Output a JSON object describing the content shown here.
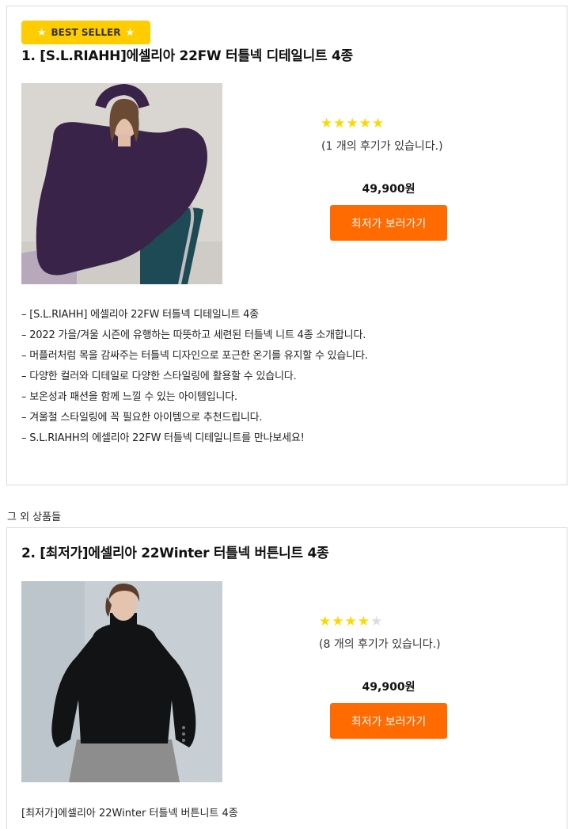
{
  "products": [
    {
      "badge": "BEST SELLER",
      "title": "1. [S.L.RIAHH]에셀리아 22FW 터틀넥 디테일니트 4종",
      "rating": 5,
      "stars_on": "★★★★★",
      "stars_off": "",
      "reviews": "(1 개의 후기가 있습니다.)",
      "price": "49,900원",
      "cta": "최저가 보러가기",
      "description": [
        "– [S.L.RIAHH] 에셀리아 22FW 터틀넥 디테일니트 4종",
        "– 2022 가을/겨울 시즌에 유행하는 따뜻하고 세련된 터틀넥 니트 4종 소개합니다.",
        "– 머플러처럼 목을 감싸주는 터틀넥 디자인으로 포근한 온기를 유지할 수 있습니다.",
        "– 다양한 컬러와 디테일로 다양한 스타일링에 활용할 수 있습니다.",
        "– 보온성과 패션을 함께 느낄 수 있는 아이템입니다.",
        "– 겨울철 스타일링에 꼭 필요한 아이템으로 추천드립니다.",
        "– S.L.RIAHH의 에셀리아 22FW 터틀넥 디테일니트를 만나보세요!"
      ]
    },
    {
      "title": "2. [최저가]에셀리아 22Winter 터틀넥 버튼니트 4종",
      "rating": 4,
      "stars_on": "★★★★",
      "stars_off": "★",
      "reviews": "(8 개의 후기가 있습니다.)",
      "price": "49,900원",
      "cta": "최저가 보러가기",
      "description": "[최저가]에셀리아 22Winter 터틀넥 버튼니트 4종"
    }
  ],
  "section_label": "그 외 상품들",
  "colors": {
    "badge": "#ffcc00",
    "star": "#ffd700",
    "star_empty": "#dddddd",
    "cta": "#ff6b00",
    "border": "#d9d9d9"
  },
  "icons": {
    "badge_star": "★",
    "rating_star": "★"
  }
}
